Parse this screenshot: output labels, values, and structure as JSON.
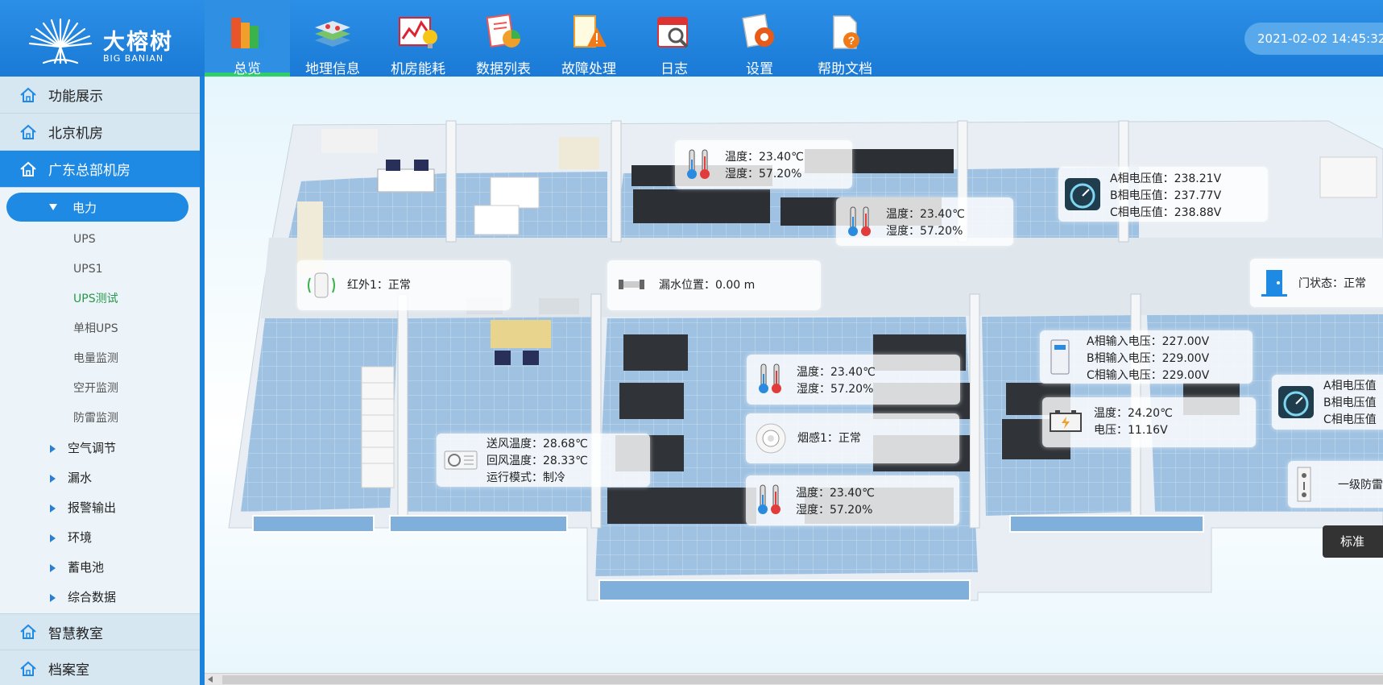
{
  "brand": {
    "name_cn": "大榕树",
    "name_en": "BIG BANIAN",
    "reg": "®"
  },
  "nav": [
    {
      "label": "总览",
      "icon": "books-icon",
      "active": true
    },
    {
      "label": "地理信息",
      "icon": "map-layers-icon",
      "active": false
    },
    {
      "label": "机房能耗",
      "icon": "energy-chart-icon",
      "active": false
    },
    {
      "label": "数据列表",
      "icon": "data-list-icon",
      "active": false
    },
    {
      "label": "故障处理",
      "icon": "warning-icon",
      "active": false
    },
    {
      "label": "日志",
      "icon": "calendar-search-icon",
      "active": false
    },
    {
      "label": "设置",
      "icon": "settings-gear-icon",
      "active": false
    },
    {
      "label": "帮助文档",
      "icon": "help-document-icon",
      "active": false
    }
  ],
  "datetime": "2021-02-02  14:45:32",
  "sidebar": {
    "top_items": [
      "功能展示",
      "北京机房",
      "广东总部机房"
    ],
    "expanded": "电力",
    "power_children": [
      "UPS",
      "UPS1",
      "UPS测试",
      "单相UPS",
      "电量监测",
      "空开监测",
      "防雷监测"
    ],
    "selected_child": "UPS测试",
    "collapsed_groups": [
      "空气调节",
      "漏水",
      "报警输出",
      "环境",
      "蓄电池",
      "综合数据"
    ],
    "bottom_items": [
      "智慧教室",
      "档案室"
    ]
  },
  "cards": {
    "th_top1": {
      "temp": "温度：23.40℃",
      "hum": "湿度：57.20%"
    },
    "th_top2": {
      "temp": "温度：23.40℃",
      "hum": "湿度：57.20%"
    },
    "volt1": {
      "a": "A相电压值：238.21V",
      "b": "B相电压值：237.77V",
      "c": "C相电压值：238.88V"
    },
    "infrared": {
      "text": "红外1：正常"
    },
    "leak": {
      "text": "漏水位置：0.00 m"
    },
    "door": {
      "text": "门状态：正常"
    },
    "th_mid1": {
      "temp": "温度：23.40℃",
      "hum": "湿度：57.20%"
    },
    "smoke": {
      "text": "烟感1：正常"
    },
    "th_mid2": {
      "temp": "温度：23.40℃",
      "hum": "湿度：57.20%"
    },
    "ups_in": {
      "a": "A相输入电压：227.00V",
      "b": "B相输入电压：229.00V",
      "c": "C相输入电压：229.00V"
    },
    "battery": {
      "temp": "温度：24.20℃",
      "volt": "电压：11.16V"
    },
    "volt2": {
      "a": "A相电压值",
      "b": "B相电压值",
      "c": "C相电压值"
    },
    "aircon": {
      "supply": "送风温度：28.68℃",
      "return": "回风温度：28.33℃",
      "mode": "运行模式：制冷"
    },
    "lightning": {
      "text": "一级防雷"
    }
  },
  "standard_button": "标准",
  "colors": {
    "topbar": "#1a7ad6",
    "accent": "#1e8ae4",
    "active_underline": "#2fcf6a",
    "selected_text": "#27984a"
  }
}
